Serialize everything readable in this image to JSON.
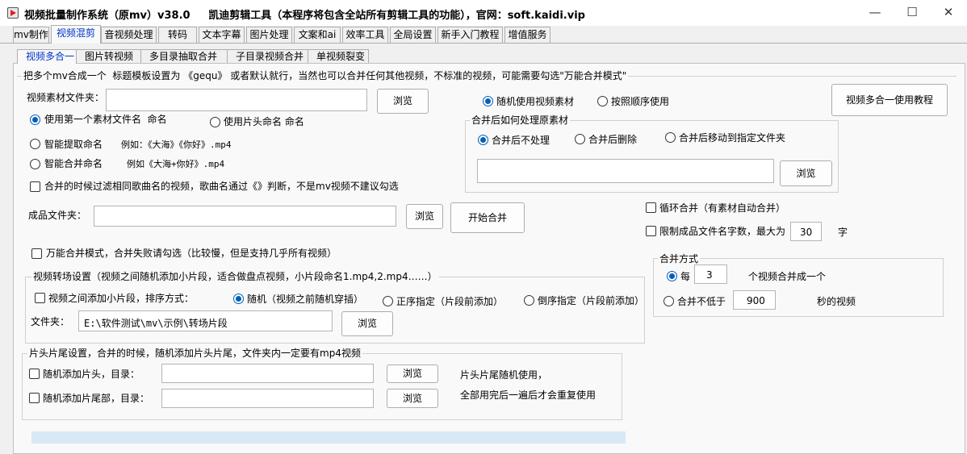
{
  "window": {
    "title": "视频批量制作系统（原mv）v38.0     凯迪剪辑工具（本程序将包含全站所有剪辑工具的功能），官网：soft.kaidi.vip",
    "minimize": "—",
    "maximize": "☐",
    "close": "✕"
  },
  "main_tabs": [
    "mv制作",
    "视频混剪",
    "音视频处理",
    "转码",
    "文本字幕",
    "图片处理",
    "文案和ai",
    "效率工具",
    "全局设置",
    "新手入门教程",
    "增值服务"
  ],
  "sub_tabs": [
    "视频多合一",
    "图片转视频",
    "多目录抽取合并",
    "子目录视频合并",
    "单视频裂变"
  ],
  "group_main": {
    "label": "把多个mv合成一个  标题模板设置为 《gequ》 或者默认就行，当然也可以合并任何其他视频，不标准的视频，可能需要勾选\"万能合并模式\""
  },
  "material": {
    "label": "视频素材文件夹：",
    "value": "",
    "browse": "浏览"
  },
  "naming": {
    "opt1": "使用第一个素材文件名  命名",
    "opt2": "使用片头命名 命名",
    "opt3": "智能提取命名",
    "opt3_example": "例如：《大海》《你好》.mp4",
    "opt4": "智能合并命名",
    "opt4_example": "例如《大海+你好》.mp4"
  },
  "filter_same": "合并的时候过滤相同歌曲名的视频，歌曲名通过《》判断，不是mv视频不建议勾选",
  "output": {
    "label": "成品文件夹：",
    "value": "",
    "browse": "浏览",
    "start": "开始合并"
  },
  "universal": "万能合并模式，合并失败请勾选（比较慢，但是支持几乎所有视频）",
  "order": {
    "random": "随机使用视频素材",
    "sequential": "按照顺序使用"
  },
  "tutorial_button": "视频多合一使用教程",
  "after_merge": {
    "label": "合并后如何处理原素材",
    "keep": "合并后不处理",
    "delete": "合并后删除",
    "move": "合并后移动到指定文件夹",
    "path": "",
    "browse": "浏览"
  },
  "loop_merge": "循环合并（有素材自动合并）",
  "limit_name": {
    "label": "限制成品文件名字数，最大为",
    "value": "30",
    "unit": "字"
  },
  "merge_method": {
    "label": "合并方式",
    "each_prefix": "每",
    "each_value": "3",
    "each_suffix": "个视频合并成一个",
    "min_prefix": "合并不低于",
    "min_value": "900",
    "min_suffix": "秒的视频"
  },
  "transition": {
    "label": "视频转场设置（视频之间随机添加小片段，适合做盘点视频，小片段命名1.mp4,2.mp4……）",
    "add": "视频之间添加小片段，排序方式：",
    "random": "随机（视频之前随机穿插）",
    "forward": "正序指定（片段前添加）",
    "reverse": "倒序指定（片段前添加）",
    "folder_label": "文件夹：",
    "folder_value": "E:\\软件测试\\mv\\示例\\转场片段",
    "browse": "浏览"
  },
  "head_tail": {
    "label": "片头片尾设置，合并的时候，随机添加片头片尾，文件夹内一定要有mp4视频",
    "head": "随机添加片头，目录：",
    "tail": "随机添加片尾部，目录：",
    "head_value": "",
    "tail_value": "",
    "browse1": "浏览",
    "browse2": "浏览",
    "note1": "片头片尾随机使用，",
    "note2": "全部用完后一遍后才会重复使用"
  },
  "progress": {
    "value": 0
  }
}
